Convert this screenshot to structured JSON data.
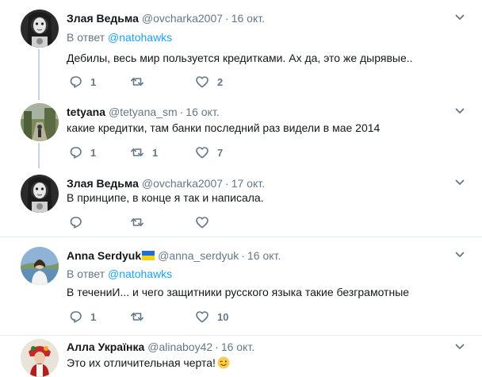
{
  "tweets": [
    {
      "name": "Злая Ведьма",
      "handle": "@ovcharka2007",
      "time": "16 окт.",
      "reply_label": "В ответ",
      "reply_mention": "@natohawks",
      "text": "Дебилы, весь мир пользуется кредитками. Ах да, это же дырявые..",
      "replies": "1",
      "retweets": "",
      "likes": "2"
    },
    {
      "name": "tetyana",
      "handle": "@tetyana_sm",
      "time": "16 окт.",
      "text": "какие кредитки, там банки последний раз видели в мае 2014",
      "replies": "1",
      "retweets": "1",
      "likes": "7"
    },
    {
      "name": "Злая Ведьма",
      "handle": "@ovcharka2007",
      "time": "17 окт.",
      "text": "В принципе, в конце я так и написала.",
      "replies": "",
      "retweets": "",
      "likes": ""
    },
    {
      "name": "Anna Serdyuk",
      "handle": "@anna_serdyuk",
      "time": "16 окт.",
      "reply_label": "В ответ",
      "reply_mention": "@natohawks",
      "text": "В течениИ... и чего защитники русского языка такие безграмотные",
      "replies": "1",
      "retweets": "",
      "likes": "10"
    },
    {
      "name": "Алла Украïнка",
      "handle": "@alinaboy42",
      "time": "16 окт.",
      "text": "Это их отличительная черта!",
      "replies": "",
      "retweets": "",
      "likes": ""
    }
  ],
  "separator": "·",
  "colors": {
    "accent": "#1da1f2",
    "muted": "#657786",
    "thread_line": "#c4d4e8",
    "divider": "#e6ecf0"
  },
  "icons": [
    "reply-icon",
    "retweet-icon",
    "like-icon",
    "chevron-down-icon",
    "ukraine-flag-icon",
    "winking-face-emoji"
  ]
}
